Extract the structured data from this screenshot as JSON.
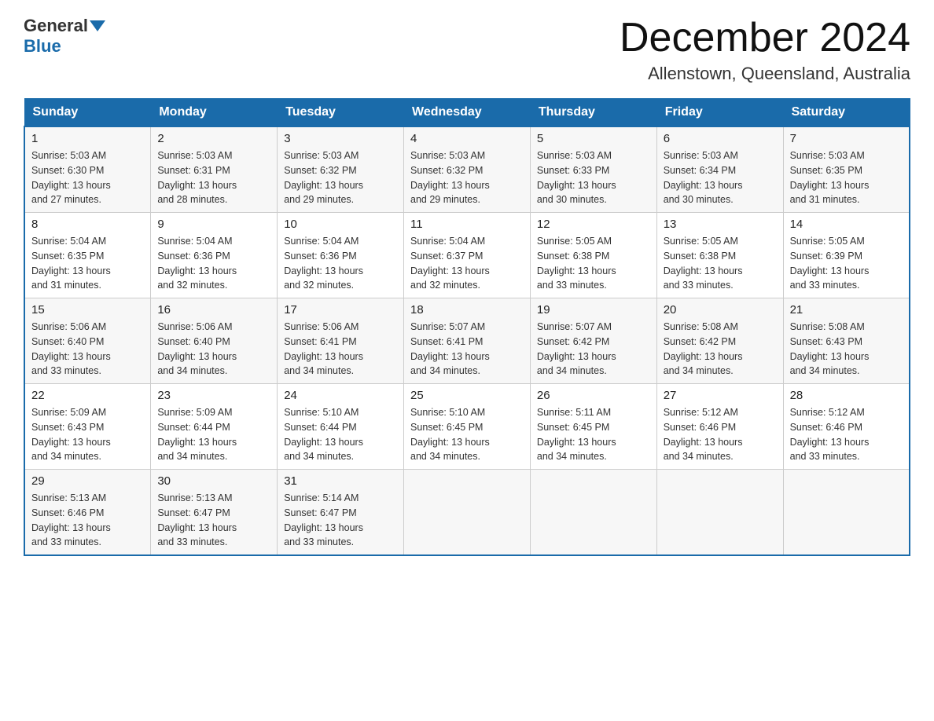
{
  "header": {
    "logo_general": "General",
    "logo_blue": "Blue",
    "title": "December 2024",
    "subtitle": "Allenstown, Queensland, Australia"
  },
  "days_of_week": [
    "Sunday",
    "Monday",
    "Tuesday",
    "Wednesday",
    "Thursday",
    "Friday",
    "Saturday"
  ],
  "weeks": [
    [
      {
        "day": "1",
        "sunrise": "5:03 AM",
        "sunset": "6:30 PM",
        "daylight": "13 hours and 27 minutes."
      },
      {
        "day": "2",
        "sunrise": "5:03 AM",
        "sunset": "6:31 PM",
        "daylight": "13 hours and 28 minutes."
      },
      {
        "day": "3",
        "sunrise": "5:03 AM",
        "sunset": "6:32 PM",
        "daylight": "13 hours and 29 minutes."
      },
      {
        "day": "4",
        "sunrise": "5:03 AM",
        "sunset": "6:32 PM",
        "daylight": "13 hours and 29 minutes."
      },
      {
        "day": "5",
        "sunrise": "5:03 AM",
        "sunset": "6:33 PM",
        "daylight": "13 hours and 30 minutes."
      },
      {
        "day": "6",
        "sunrise": "5:03 AM",
        "sunset": "6:34 PM",
        "daylight": "13 hours and 30 minutes."
      },
      {
        "day": "7",
        "sunrise": "5:03 AM",
        "sunset": "6:35 PM",
        "daylight": "13 hours and 31 minutes."
      }
    ],
    [
      {
        "day": "8",
        "sunrise": "5:04 AM",
        "sunset": "6:35 PM",
        "daylight": "13 hours and 31 minutes."
      },
      {
        "day": "9",
        "sunrise": "5:04 AM",
        "sunset": "6:36 PM",
        "daylight": "13 hours and 32 minutes."
      },
      {
        "day": "10",
        "sunrise": "5:04 AM",
        "sunset": "6:36 PM",
        "daylight": "13 hours and 32 minutes."
      },
      {
        "day": "11",
        "sunrise": "5:04 AM",
        "sunset": "6:37 PM",
        "daylight": "13 hours and 32 minutes."
      },
      {
        "day": "12",
        "sunrise": "5:05 AM",
        "sunset": "6:38 PM",
        "daylight": "13 hours and 33 minutes."
      },
      {
        "day": "13",
        "sunrise": "5:05 AM",
        "sunset": "6:38 PM",
        "daylight": "13 hours and 33 minutes."
      },
      {
        "day": "14",
        "sunrise": "5:05 AM",
        "sunset": "6:39 PM",
        "daylight": "13 hours and 33 minutes."
      }
    ],
    [
      {
        "day": "15",
        "sunrise": "5:06 AM",
        "sunset": "6:40 PM",
        "daylight": "13 hours and 33 minutes."
      },
      {
        "day": "16",
        "sunrise": "5:06 AM",
        "sunset": "6:40 PM",
        "daylight": "13 hours and 34 minutes."
      },
      {
        "day": "17",
        "sunrise": "5:06 AM",
        "sunset": "6:41 PM",
        "daylight": "13 hours and 34 minutes."
      },
      {
        "day": "18",
        "sunrise": "5:07 AM",
        "sunset": "6:41 PM",
        "daylight": "13 hours and 34 minutes."
      },
      {
        "day": "19",
        "sunrise": "5:07 AM",
        "sunset": "6:42 PM",
        "daylight": "13 hours and 34 minutes."
      },
      {
        "day": "20",
        "sunrise": "5:08 AM",
        "sunset": "6:42 PM",
        "daylight": "13 hours and 34 minutes."
      },
      {
        "day": "21",
        "sunrise": "5:08 AM",
        "sunset": "6:43 PM",
        "daylight": "13 hours and 34 minutes."
      }
    ],
    [
      {
        "day": "22",
        "sunrise": "5:09 AM",
        "sunset": "6:43 PM",
        "daylight": "13 hours and 34 minutes."
      },
      {
        "day": "23",
        "sunrise": "5:09 AM",
        "sunset": "6:44 PM",
        "daylight": "13 hours and 34 minutes."
      },
      {
        "day": "24",
        "sunrise": "5:10 AM",
        "sunset": "6:44 PM",
        "daylight": "13 hours and 34 minutes."
      },
      {
        "day": "25",
        "sunrise": "5:10 AM",
        "sunset": "6:45 PM",
        "daylight": "13 hours and 34 minutes."
      },
      {
        "day": "26",
        "sunrise": "5:11 AM",
        "sunset": "6:45 PM",
        "daylight": "13 hours and 34 minutes."
      },
      {
        "day": "27",
        "sunrise": "5:12 AM",
        "sunset": "6:46 PM",
        "daylight": "13 hours and 34 minutes."
      },
      {
        "day": "28",
        "sunrise": "5:12 AM",
        "sunset": "6:46 PM",
        "daylight": "13 hours and 33 minutes."
      }
    ],
    [
      {
        "day": "29",
        "sunrise": "5:13 AM",
        "sunset": "6:46 PM",
        "daylight": "13 hours and 33 minutes."
      },
      {
        "day": "30",
        "sunrise": "5:13 AM",
        "sunset": "6:47 PM",
        "daylight": "13 hours and 33 minutes."
      },
      {
        "day": "31",
        "sunrise": "5:14 AM",
        "sunset": "6:47 PM",
        "daylight": "13 hours and 33 minutes."
      },
      null,
      null,
      null,
      null
    ]
  ],
  "labels": {
    "sunrise": "Sunrise:",
    "sunset": "Sunset:",
    "daylight": "Daylight:"
  }
}
